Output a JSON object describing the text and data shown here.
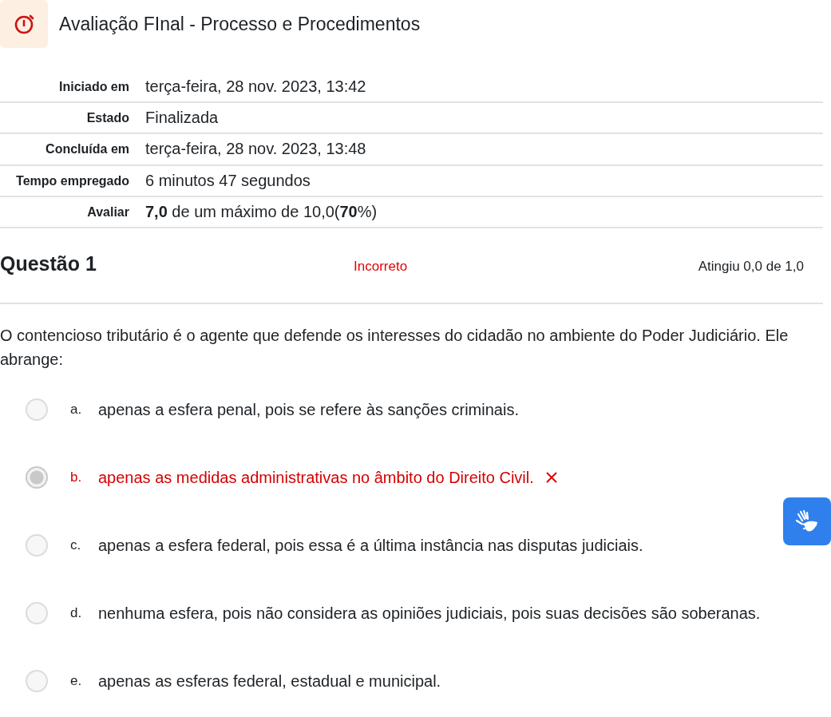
{
  "title": "Avaliação FInal - Processo e Procedimentos",
  "summary": [
    {
      "label": "Iniciado em",
      "value": "terça-feira, 28 nov. 2023, 13:42"
    },
    {
      "label": "Estado",
      "value": "Finalizada"
    },
    {
      "label": "Concluída em",
      "value": "terça-feira, 28 nov. 2023, 13:48"
    },
    {
      "label": "Tempo empregado",
      "value": "6 minutos 47 segundos"
    },
    {
      "label": "Avaliar",
      "value": "**7,0** de um máximo de 10,0(**70**%)"
    }
  ],
  "question": {
    "heading": "Questão 1",
    "status": {
      "kind": "incorrect",
      "text": "Incorreto"
    },
    "grade": "Atingiu 0,0 de 1,0",
    "text": "O contencioso tributário é o agente que defende os interesses do cidadão no ambiente do Poder Judiciário. Ele abrange:",
    "options": [
      {
        "letter": "a.",
        "text": "apenas a esfera penal, pois se refere às sanções criminais.",
        "selected": false,
        "incorrect": false
      },
      {
        "letter": "b.",
        "text": "apenas as medidas administrativas no âmbito do Direito Civil.",
        "selected": true,
        "incorrect": true
      },
      {
        "letter": "c.",
        "text": "apenas a esfera federal, pois essa é a última instância nas disputas judiciais.",
        "selected": false,
        "incorrect": false
      },
      {
        "letter": "d.",
        "text": "nenhuma esfera, pois não considera as opiniões judiciais, pois suas decisões são soberanas.",
        "selected": false,
        "incorrect": false
      },
      {
        "letter": "e.",
        "text": "apenas as esferas federal, estadual e municipal.",
        "selected": false,
        "incorrect": false
      }
    ]
  }
}
